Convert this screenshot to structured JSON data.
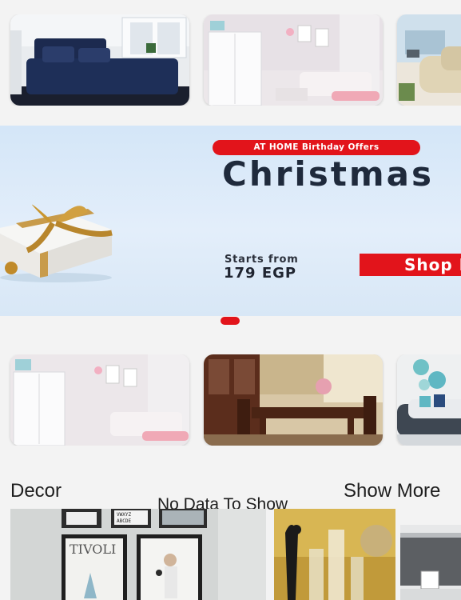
{
  "top_categories": [
    {
      "name": "bedroom"
    },
    {
      "name": "kids-room"
    },
    {
      "name": "living-room"
    }
  ],
  "banner": {
    "pill_text": "AT HOME Birthday Offers",
    "title": "Christmas",
    "starts_label": "Starts from",
    "price": "179 EGP",
    "cta": "Shop Now",
    "accent_color": "#e2141b"
  },
  "bottom_categories": [
    {
      "name": "kids-room"
    },
    {
      "name": "dining-room"
    },
    {
      "name": "living-room"
    }
  ],
  "decor_section": {
    "title": "Decor",
    "empty_message": "No Data To Show",
    "show_more": "Show More",
    "poster_text_top": "VWXYZ ABCDEFGH",
    "poster_text_main": "TIVOLI"
  }
}
